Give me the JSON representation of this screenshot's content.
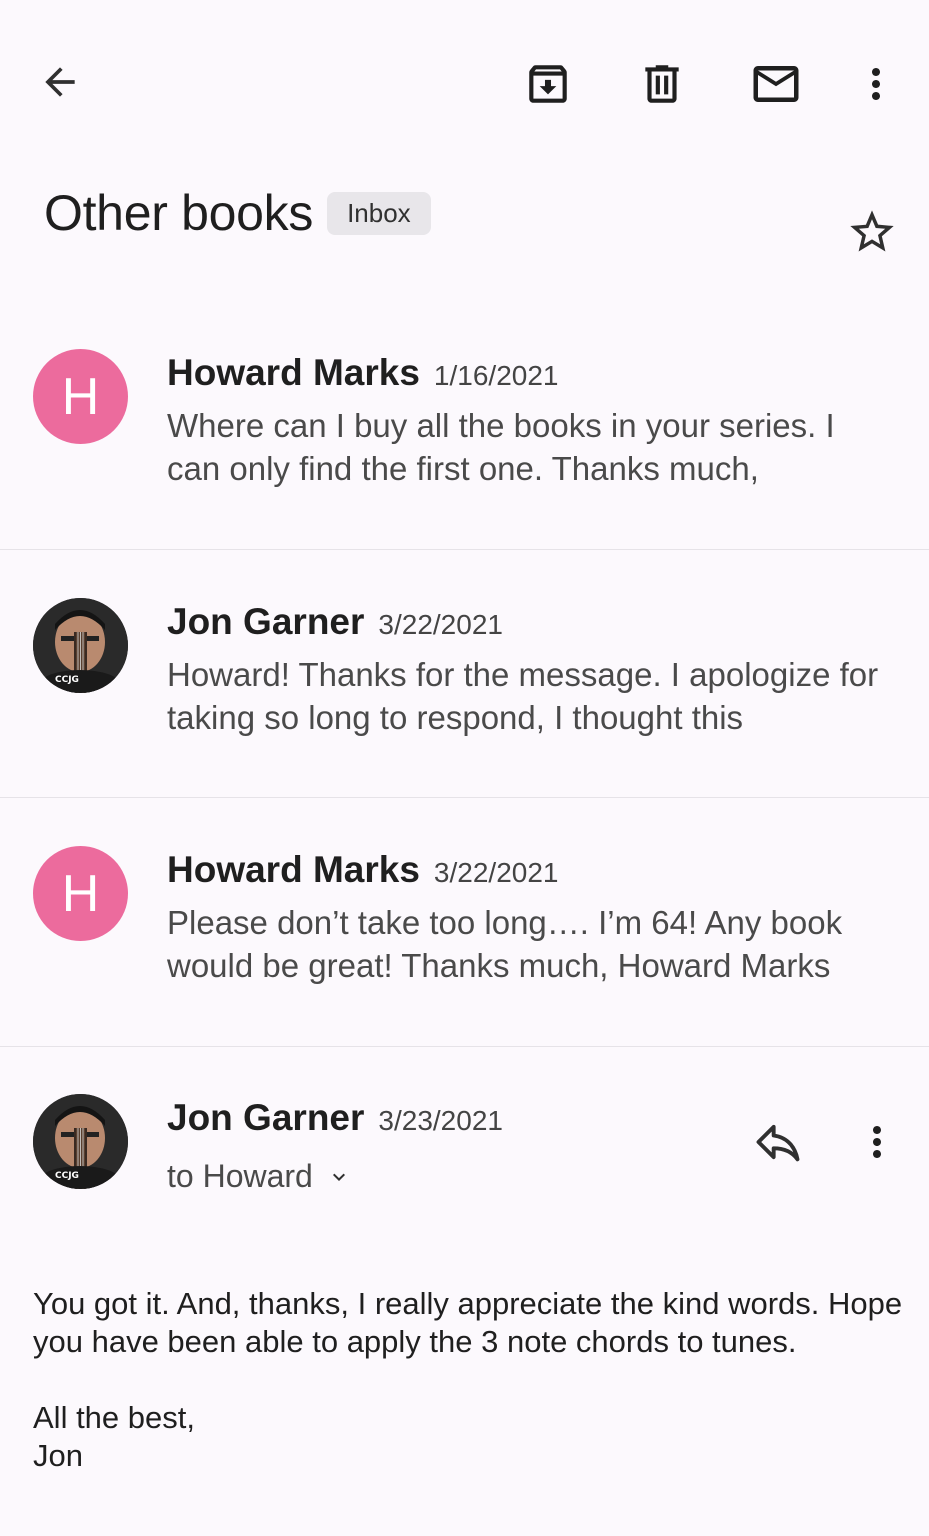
{
  "toolbar": {
    "back_icon": "arrow-back-icon",
    "archive_icon": "archive-icon",
    "delete_icon": "trash-icon",
    "mark_unread_icon": "mail-icon",
    "more_icon": "more-vert-icon"
  },
  "thread": {
    "subject": "Other books",
    "label": "Inbox",
    "star_icon": "star-outline-icon"
  },
  "messages": [
    {
      "avatar_letter": "H",
      "avatar_color": "#ec6b9d",
      "sender": "Howard Marks",
      "date": "1/16/2021",
      "snippet": "Where can I buy all the books in your series. I can only find the first one. Thanks much,"
    },
    {
      "avatar_photo": "CCJG",
      "sender": "Jon Garner",
      "date": "3/22/2021",
      "snippet": "Howard! Thanks for the message. I apologize for taking so long to respond, I thought this"
    },
    {
      "avatar_letter": "H",
      "avatar_color": "#ec6b9d",
      "sender": "Howard Marks",
      "date": "3/22/2021",
      "snippet": "Please don’t take too long…. I’m 64! Any book would be great! Thanks much, Howard Marks"
    }
  ],
  "open_message": {
    "avatar_photo": "CCJG",
    "sender": "Jon Garner",
    "date": "3/23/2021",
    "recipient": "to Howard",
    "reply_icon": "reply-icon",
    "more_icon": "more-vert-icon",
    "body": [
      "You got it.  And, thanks, I really appreciate the kind words. Hope you have been able to apply the 3 note chords to tunes.",
      "All the best,",
      "Jon"
    ]
  }
}
